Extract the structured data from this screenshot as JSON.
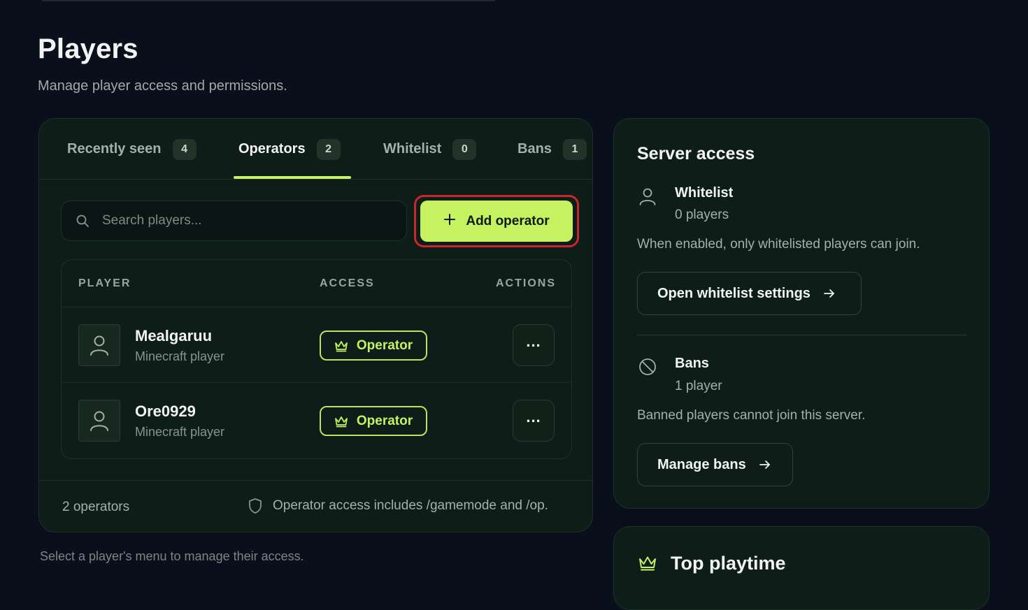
{
  "header": {
    "title": "Players",
    "subtitle": "Manage player access and permissions."
  },
  "tabs": [
    {
      "label": "Recently seen",
      "count": "4",
      "active": false
    },
    {
      "label": "Operators",
      "count": "2",
      "active": true
    },
    {
      "label": "Whitelist",
      "count": "0",
      "active": false
    },
    {
      "label": "Bans",
      "count": "1",
      "active": false
    }
  ],
  "search": {
    "placeholder": "Search players..."
  },
  "add_button": {
    "label": "Add operator"
  },
  "table": {
    "columns": [
      "PLAYER",
      "ACCESS",
      "ACTIONS"
    ],
    "rows": [
      {
        "name": "Mealgaruu",
        "subtitle": "Minecraft player",
        "access": "Operator",
        "menu": "..."
      },
      {
        "name": "Ore0929",
        "subtitle": "Minecraft player",
        "access": "Operator",
        "menu": "..."
      }
    ]
  },
  "footer": {
    "count": "2 operators",
    "note": "Operator access includes /gamemode and /op."
  },
  "hint": "Select a player's menu to manage their access.",
  "server_access": {
    "title": "Server access",
    "whitelist": {
      "title": "Whitelist",
      "count": "0 players",
      "description": "When enabled, only whitelisted players can join.",
      "button": "Open whitelist settings"
    },
    "bans": {
      "title": "Bans",
      "count": "1 player",
      "description": "Banned players cannot join this server.",
      "button": "Manage bans"
    }
  },
  "top_playtime": {
    "title": "Top playtime"
  },
  "colors": {
    "background": "#0a0f1c",
    "card": "#0e1d17",
    "accent": "#c4f261",
    "highlight_ring": "#c8272f"
  },
  "icons": [
    "search-icon",
    "plus-icon",
    "user-icon",
    "crown-icon",
    "more-icon",
    "shield-icon",
    "ban-icon",
    "arrow-right-icon"
  ]
}
